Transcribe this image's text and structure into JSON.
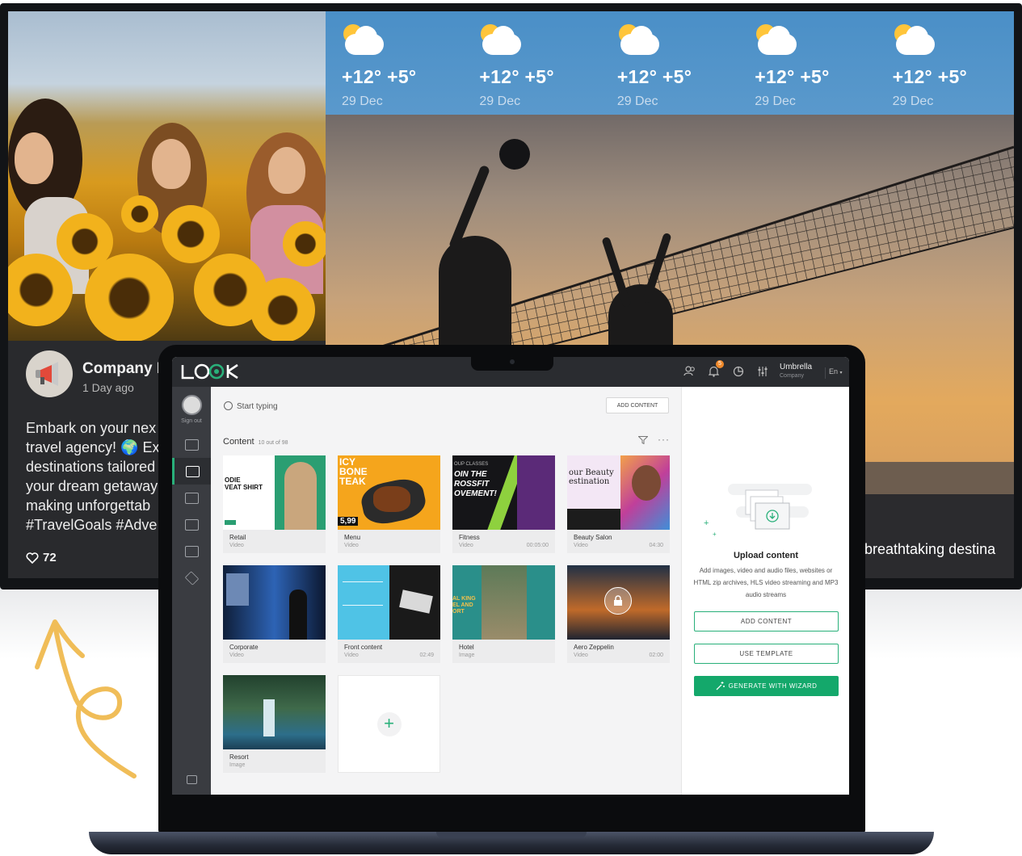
{
  "social_post": {
    "company": "Company N",
    "time_ago": "1 Day ago",
    "text_lines": [
      "Embark on your nex",
      "travel agency! 🌍 Ex",
      "destinations tailored",
      "your dream getaway",
      "making unforgettab",
      "#TravelGoals #Adve"
    ],
    "likes": "72"
  },
  "weather": [
    {
      "temp": "+12° +5°",
      "date": "29 Dec"
    },
    {
      "temp": "+12° +5°",
      "date": "29 Dec"
    },
    {
      "temp": "+12° +5°",
      "date": "29 Dec"
    },
    {
      "temp": "+12° +5°",
      "date": "29 Dec"
    },
    {
      "temp": "+12° +5°",
      "date": "29 Dec"
    }
  ],
  "ticker_text": "e breathtaking destina",
  "app": {
    "logo": "LOOK",
    "notifications_count": "5",
    "account": {
      "name": "Umbrella",
      "subtitle": "Company"
    },
    "language": "En",
    "sidebar_signout": "Sign out",
    "search_placeholder": "Start typing",
    "add_content_small": "ADD CONTENT",
    "content_title": "Content",
    "content_count": "10 out of 98",
    "cards": [
      {
        "title": "Retail",
        "type": "Video",
        "duration": ""
      },
      {
        "title": "Menu",
        "type": "Video",
        "duration": ""
      },
      {
        "title": "Fitness",
        "type": "Video",
        "duration": "00:05:00"
      },
      {
        "title": "Beauty Salon",
        "type": "Video",
        "duration": "04:30"
      },
      {
        "title": "Corporate",
        "type": "Video",
        "duration": ""
      },
      {
        "title": "Front content",
        "type": "Video",
        "duration": "02:49"
      },
      {
        "title": "Hotel",
        "type": "Image",
        "duration": ""
      },
      {
        "title": "Aero Zeppelin",
        "type": "Video",
        "duration": "02:00"
      },
      {
        "title": "Resort",
        "type": "Image",
        "duration": ""
      }
    ],
    "thumb_text": {
      "retail": [
        "ODIE",
        "VEAT SHIRT"
      ],
      "menu": [
        "ICY",
        "BONE",
        "TEAK",
        "5,99"
      ],
      "fitness": [
        "OUP CLASSES",
        "OIN THE",
        "ROSSFIT",
        "OVEMENT!"
      ],
      "beauty": [
        "our Beauty",
        "estination"
      ],
      "hotel": [
        "AL KING",
        "EL AND",
        "ORT"
      ]
    },
    "upload": {
      "title": "Upload content",
      "description": "Add images, video and audio files, websites or HTML zip archives, HLS video streaming and MP3 audio streams",
      "add_content": "ADD CONTENT",
      "use_template": "USE TEMPLATE",
      "wizard": "GENERATE WITH WIZARD"
    }
  },
  "colors": {
    "accent": "#14a86b",
    "weather_bar": "#4a8fc7",
    "doodle": "#f0bd58",
    "notification": "#f08a2b"
  }
}
